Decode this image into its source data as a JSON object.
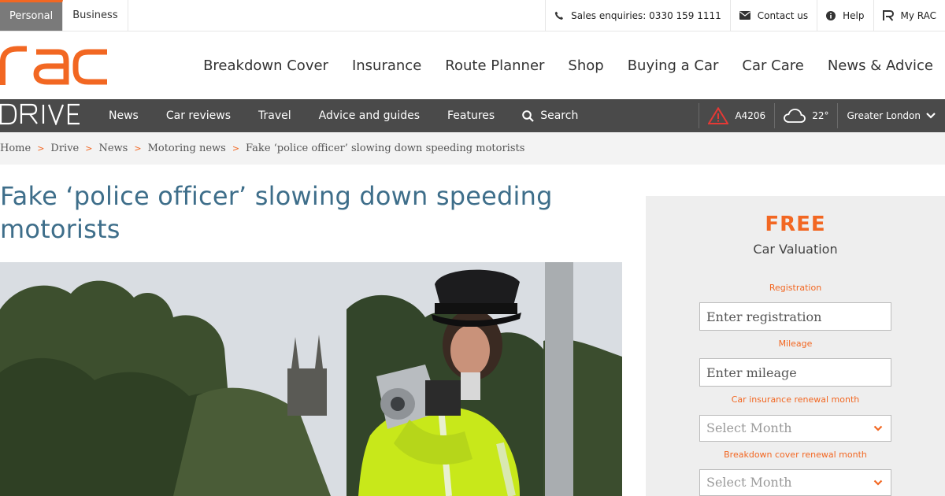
{
  "segment_tabs": [
    {
      "label": "Personal",
      "active": true
    },
    {
      "label": "Business",
      "active": false
    }
  ],
  "utility": {
    "sales": "Sales enquiries: 0330 159 1111",
    "contact": "Contact us",
    "help": "Help",
    "myrac": "My RAC"
  },
  "brand": {
    "accent": "#f26722",
    "title_color": "#3e6e8a",
    "drive_bar": "#4a4a4a"
  },
  "main_nav": [
    "Breakdown Cover",
    "Insurance",
    "Route Planner",
    "Shop",
    "Buying a Car",
    "Car Care",
    "News & Advice"
  ],
  "drive_nav": {
    "items": [
      "News",
      "Car reviews",
      "Travel",
      "Advice and guides",
      "Features"
    ],
    "search": "Search",
    "traffic_road": "A4206",
    "temperature": "22°",
    "region": "Greater London"
  },
  "breadcrumb": [
    "Home",
    "Drive",
    "News",
    "Motoring news",
    "Fake ‘police officer’ slowing down speeding motorists"
  ],
  "article": {
    "title": "Fake ‘police officer’ slowing down speeding motorists"
  },
  "widget": {
    "free": "FREE",
    "subtitle": "Car Valuation",
    "registration_label": "Registration",
    "registration_placeholder": "Enter registration",
    "mileage_label": "Mileage",
    "mileage_placeholder": "Enter mileage",
    "insurance_label": "Car insurance renewal month",
    "insurance_value": "Select Month",
    "breakdown_label": "Breakdown cover renewal month",
    "breakdown_value": "Select Month"
  }
}
